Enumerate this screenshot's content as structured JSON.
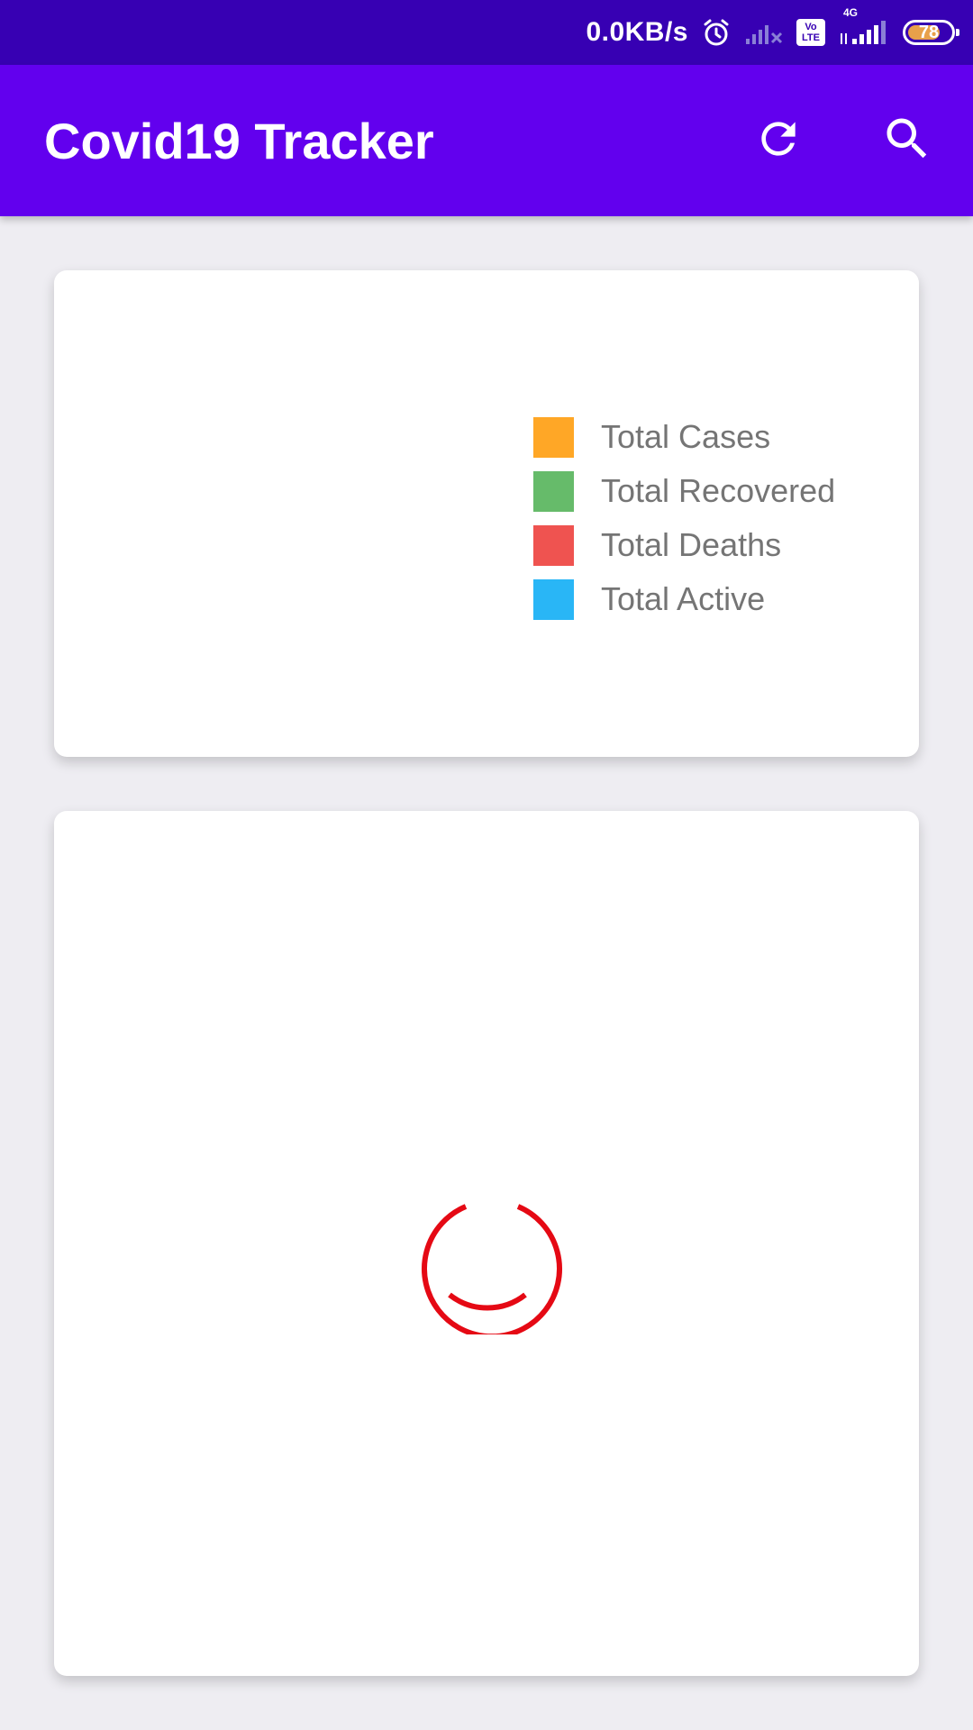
{
  "status_bar": {
    "net_speed": "0.0KB/s",
    "volte": "Vo LTE",
    "network_type": "4G",
    "battery_level": "78",
    "battery_fraction": 0.78,
    "icons": [
      "alarm-icon",
      "signal-no-service-icon",
      "volte-icon",
      "signal-4g-icon",
      "battery-icon"
    ]
  },
  "app_bar": {
    "title": "Covid19 Tracker",
    "actions": [
      "refresh-icon",
      "search-icon"
    ],
    "color": "#6200ee"
  },
  "legend": {
    "items": [
      {
        "label": "Total Cases",
        "color": "#ffa726"
      },
      {
        "label": "Total Recovered",
        "color": "#66bb6a"
      },
      {
        "label": "Total Deaths",
        "color": "#ef5350"
      },
      {
        "label": "Total Active",
        "color": "#29b6f6"
      }
    ]
  },
  "loading": {
    "indicator": "progress-spinner-icon",
    "color": "#e50914"
  }
}
